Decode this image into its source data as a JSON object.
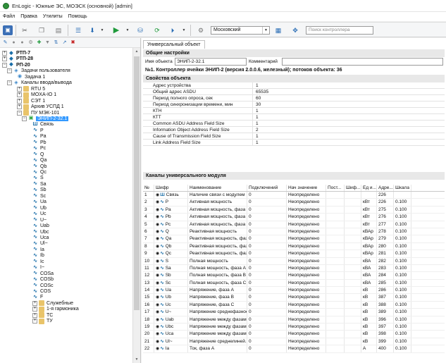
{
  "window": {
    "title": "EnLogic - Южные ЭС, МОЭСК (основной) [admin]"
  },
  "menu": [
    "Файл",
    "Правка",
    "Утилиты",
    "Помощь"
  ],
  "toolbar": {
    "combo_value": "Московский",
    "search_placeholder": "Поиск контроллера"
  },
  "tree": {
    "nodes": [
      {
        "label": "РТП-7",
        "bold": true
      },
      {
        "label": "РТП-28",
        "bold": true
      },
      {
        "label": "РП-20",
        "bold": true
      },
      {
        "label": "Задачи пользователя"
      },
      {
        "label": "Задача 1"
      },
      {
        "label": "Каналы ввода/вывода"
      },
      {
        "label": "RTU 5"
      },
      {
        "label": "MOXA-IO 1"
      },
      {
        "label": "СЭТ 1"
      },
      {
        "label": "Архив УСПД 1"
      },
      {
        "label": "ПУ МЭК-101"
      },
      {
        "label": "ЭНИП-2-32.1"
      },
      {
        "label": "Связь"
      },
      {
        "label": "P"
      },
      {
        "label": "Pa"
      },
      {
        "label": "Pb"
      },
      {
        "label": "Pc"
      },
      {
        "label": "Q"
      },
      {
        "label": "Qa"
      },
      {
        "label": "Qb"
      },
      {
        "label": "Qc"
      },
      {
        "label": "S"
      },
      {
        "label": "Sa"
      },
      {
        "label": "Sb"
      },
      {
        "label": "Sc"
      },
      {
        "label": "Ua"
      },
      {
        "label": "Ub"
      },
      {
        "label": "Uc"
      },
      {
        "label": "U~"
      },
      {
        "label": "Uab"
      },
      {
        "label": "Ubc"
      },
      {
        "label": "Uca"
      },
      {
        "label": "Ul~"
      },
      {
        "label": "Ia"
      },
      {
        "label": "Ib"
      },
      {
        "label": "Ic"
      },
      {
        "label": "I~"
      },
      {
        "label": "COSa"
      },
      {
        "label": "COSb"
      },
      {
        "label": "COSc"
      },
      {
        "label": "COS"
      },
      {
        "label": "F"
      },
      {
        "label": "Служебные"
      },
      {
        "label": "1-я гармоника"
      },
      {
        "label": "ТС"
      },
      {
        "label": "ТУ"
      }
    ]
  },
  "right": {
    "tab": "Универсальный объект",
    "general_header": "Общие настройки",
    "object_name_label": "Имя объекта",
    "object_name_value": "ЭНИП-2-32.1",
    "comment_label": "Комментарий",
    "info_line": "№1. Контроллер ячейки ЭНИП-2 (версия 2.0.0.6, железный); потоков объекта: 36",
    "props_header": "Свойства объекта",
    "props": [
      {
        "name": "Адрес устройства",
        "value": "1"
      },
      {
        "name": "Общий адрес ASDU",
        "value": "65535"
      },
      {
        "name": "Период полного опроса, сек",
        "value": "60"
      },
      {
        "name": "Период синхронизации времени, мин",
        "value": "30"
      },
      {
        "name": "КТН",
        "value": "1"
      },
      {
        "name": "КТТ",
        "value": "1"
      },
      {
        "name": "Common ASDU Address Field Size",
        "value": "1"
      },
      {
        "name": "Information Object Address Field Size",
        "value": "2"
      },
      {
        "name": "Cause of Transmission Field Size",
        "value": "1"
      },
      {
        "name": "Link Address Field Size",
        "value": "1"
      }
    ],
    "channels_header": "Каналы универсального модуля",
    "columns": [
      "№",
      "Шифр",
      "Наименование",
      "Подключений",
      "Нач значение",
      "Пост...",
      "Шиф...",
      "Ед и...",
      "Адре...",
      "Шкала"
    ],
    "rows": [
      [
        "1",
        "Связь",
        "Наличие связи с модулем",
        "0",
        "Неопределено",
        "",
        "",
        "",
        "226",
        ""
      ],
      [
        "2",
        "P",
        "Активная мощность",
        "0",
        "Неопределено",
        "",
        "",
        "кВт",
        "226",
        "0.100"
      ],
      [
        "3",
        "Pa",
        "Активная мощность, фаза А",
        "0",
        "Неопределено",
        "",
        "",
        "кВт",
        "275",
        "0.100"
      ],
      [
        "4",
        "Pb",
        "Активная мощность, фаза В",
        "0",
        "Неопределено",
        "",
        "",
        "кВт",
        "276",
        "0.100"
      ],
      [
        "5",
        "Pc",
        "Активная мощность, фаза С",
        "0",
        "Неопределено",
        "",
        "",
        "кВт",
        "277",
        "0.100"
      ],
      [
        "6",
        "Q",
        "Реактивная мощность",
        "0",
        "Неопределено",
        "",
        "",
        "кВАр",
        "278",
        "0.100"
      ],
      [
        "7",
        "Qa",
        "Реактивная мощность, фаз...",
        "0",
        "Неопределено",
        "",
        "",
        "кВАр",
        "279",
        "0.100"
      ],
      [
        "8",
        "Qb",
        "Реактивная мощность, фаз...",
        "0",
        "Неопределено",
        "",
        "",
        "кВАр",
        "280",
        "0.100"
      ],
      [
        "9",
        "Qc",
        "Реактивная мощность, фаз...",
        "0",
        "Неопределено",
        "",
        "",
        "кВАр",
        "281",
        "0.100"
      ],
      [
        "10",
        "S",
        "Полная мощность",
        "0",
        "Неопределено",
        "",
        "",
        "кВА",
        "282",
        "0.100"
      ],
      [
        "11",
        "Sa",
        "Полная мощность, фаза А",
        "0",
        "Неопределено",
        "",
        "",
        "кВА",
        "283",
        "0.100"
      ],
      [
        "12",
        "Sb",
        "Полная мощность, фаза В",
        "0",
        "Неопределено",
        "",
        "",
        "кВА",
        "284",
        "0.100"
      ],
      [
        "13",
        "Sc",
        "Полная мощность, фаза С",
        "0",
        "Неопределено",
        "",
        "",
        "кВА",
        "285",
        "0.100"
      ],
      [
        "14",
        "Ua",
        "Напряжение, фаза А",
        "0",
        "Неопределено",
        "",
        "",
        "кВ",
        "286",
        "0.100"
      ],
      [
        "15",
        "Ub",
        "Напряжение, фаза В",
        "0",
        "Неопределено",
        "",
        "",
        "кВ",
        "387",
        "0.100"
      ],
      [
        "16",
        "Uc",
        "Напряжение, фаза С",
        "0",
        "Неопределено",
        "",
        "",
        "кВ",
        "388",
        "0.100"
      ],
      [
        "17",
        "U~",
        "Напряжение среднефазное",
        "0",
        "Неопределено",
        "",
        "",
        "кВ",
        "389",
        "0.100"
      ],
      [
        "18",
        "Uab",
        "Напряжение между фазам...",
        "0",
        "Неопределено",
        "",
        "",
        "кВ",
        "396",
        "0.100"
      ],
      [
        "19",
        "Ubc",
        "Напряжение между фазам...",
        "0",
        "Неопределено",
        "",
        "",
        "кВ",
        "397",
        "0.100"
      ],
      [
        "20",
        "Uca",
        "Напряжение между фазам...",
        "0",
        "Неопределено",
        "",
        "",
        "кВ",
        "398",
        "0.100"
      ],
      [
        "21",
        "Ul~",
        "Напряжение среднелиней...",
        "0",
        "Неопределено",
        "",
        "",
        "кВ",
        "399",
        "0.100"
      ],
      [
        "22",
        "Ia",
        "Ток, фаза А",
        "0",
        "Неопределено",
        "",
        "",
        "А",
        "400",
        "0.100"
      ]
    ]
  }
}
